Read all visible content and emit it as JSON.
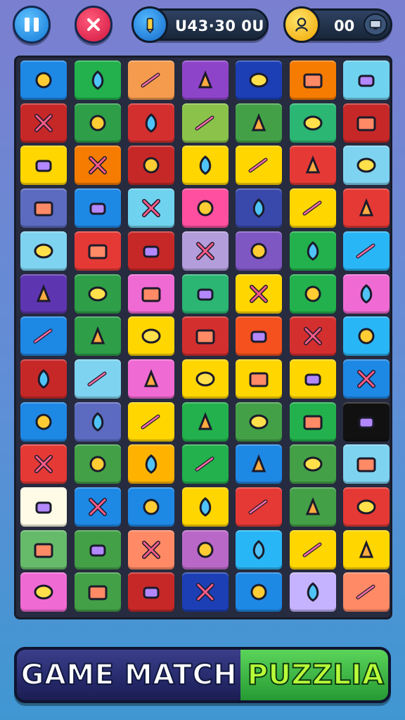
{
  "hud": {
    "score_text": "U43·30 0U",
    "coins_text": "00",
    "icons": [
      "pause-icon",
      "close-icon",
      "pencil-icon",
      "person-icon",
      "monitor-icon"
    ]
  },
  "board": {
    "columns": 7,
    "rows": 13,
    "tiles": [
      [
        "#1e88e5",
        "#22b14c",
        "#f59b4e",
        "#8e44c9",
        "#1c3fb5",
        "#f57c00",
        "#6fd2ef"
      ],
      [
        "#c62828",
        "#2e9e48",
        "#d32f2f",
        "#8bc34a",
        "#43a047",
        "#2bb673",
        "#c62828"
      ],
      [
        "#ffd600",
        "#f57c00",
        "#c62828",
        "#ffd600",
        "#ffd600",
        "#e53935",
        "#7ed3f0"
      ],
      [
        "#5c6bc0",
        "#1e88e5",
        "#6fd2ef",
        "#ff4fa0",
        "#3949ab",
        "#ffd600",
        "#e53935"
      ],
      [
        "#7ed3f0",
        "#e53935",
        "#c62828",
        "#b39ddb",
        "#7e57c2",
        "#22b14c",
        "#29b6f6"
      ],
      [
        "#5e35b1",
        "#2e9e48",
        "#f06ad3",
        "#2bb673",
        "#ffd600",
        "#22b14c",
        "#f06ad3"
      ],
      [
        "#1e88e5",
        "#2e9e48",
        "#ffd600",
        "#d32f2f",
        "#f4511e",
        "#d32f2f",
        "#29b6f6"
      ],
      [
        "#c62828",
        "#7ed3f0",
        "#f06ad3",
        "#ffd600",
        "#ffd600",
        "#ffd600",
        "#1e88e5"
      ],
      [
        "#1e88e5",
        "#5c6bc0",
        "#ffd600",
        "#22b14c",
        "#43a047",
        "#22b14c",
        "#111111"
      ],
      [
        "#e53935",
        "#43a047",
        "#ffb300",
        "#22b14c",
        "#1e88e5",
        "#43a047",
        "#7ed3f0"
      ],
      [
        "#fffbe6",
        "#1e88e5",
        "#1e88e5",
        "#ffd600",
        "#e53935",
        "#43a047",
        "#e53935"
      ],
      [
        "#66bb6a",
        "#43a047",
        "#ff8a65",
        "#ba68c8",
        "#29b6f6",
        "#ffd600",
        "#ffd600"
      ],
      [
        "#f06ad3",
        "#43a047",
        "#c62828",
        "#1c3fb5",
        "#1e88e5",
        "#c5b3ff",
        "#ff8a65"
      ]
    ]
  },
  "title": {
    "word1": "GAME",
    "word2": "MATCH",
    "word3": "PUZZLIA"
  }
}
